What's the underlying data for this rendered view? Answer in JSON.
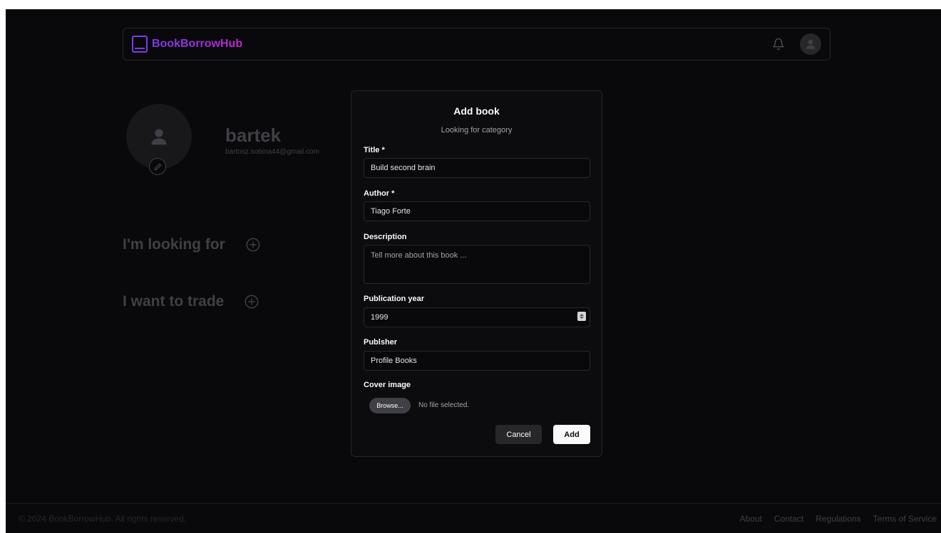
{
  "header": {
    "brand": "BookBorrowHub",
    "icons": {
      "logo": "book-icon",
      "notifications": "bell-icon",
      "avatar": "user-icon"
    }
  },
  "profile": {
    "name": "bartek",
    "email": "bartosz.sobina44@gmail.com",
    "sections": [
      {
        "title": "I'm looking for",
        "icon": "plus-circle-icon"
      },
      {
        "title": "I want to trade",
        "icon": "plus-circle-icon"
      }
    ]
  },
  "modal": {
    "title": "Add book",
    "subtitle": "Looking for category",
    "fields": {
      "title": {
        "label": "Title *",
        "value": "Build second brain"
      },
      "author": {
        "label": "Author *",
        "value": "Tiago Forte"
      },
      "description": {
        "label": "Description",
        "placeholder": "Tell more about this book ...",
        "value": ""
      },
      "publication_year": {
        "label": "Publication year",
        "value": "1999"
      },
      "publisher": {
        "label": "Publsher",
        "value": "Profile Books"
      },
      "cover_image": {
        "label": "Cover image",
        "button": "Browse...",
        "status": "No file selected."
      }
    },
    "actions": {
      "cancel": "Cancel",
      "add": "Add"
    }
  },
  "footer": {
    "copyright": "© 2024 BookBorrowHub. All rights reserved.",
    "links": [
      "About",
      "Contact",
      "Regulations",
      "Terms of Service"
    ]
  },
  "colors": {
    "background": "#09090b",
    "brand_start": "#7c3aed",
    "brand_end": "#c026d3",
    "modal_bg": "#0c0c0e",
    "border": "#27272a"
  }
}
